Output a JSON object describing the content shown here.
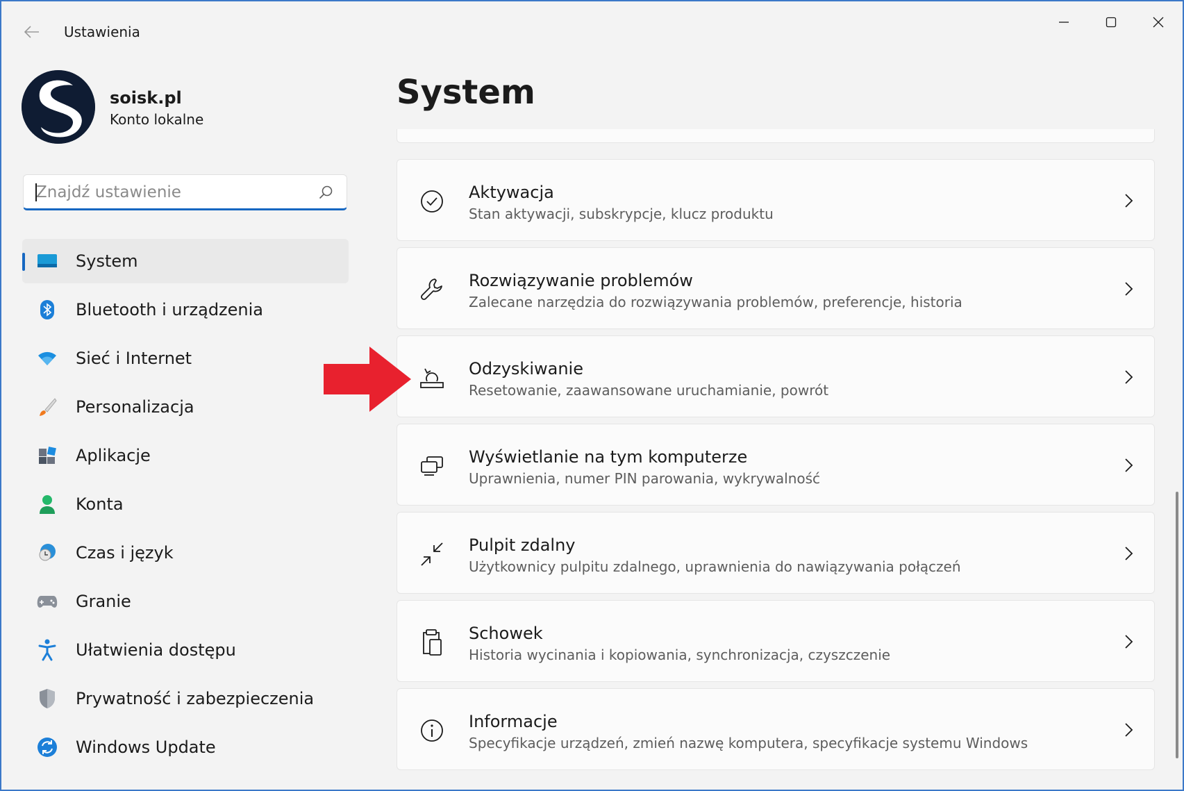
{
  "window": {
    "title": "Ustawienia"
  },
  "profile": {
    "name": "soisk.pl",
    "account_type": "Konto lokalne"
  },
  "search": {
    "placeholder": "Znajdź ustawienie"
  },
  "nav": {
    "items": [
      {
        "label": "System",
        "icon": "system-icon",
        "active": true
      },
      {
        "label": "Bluetooth i urządzenia",
        "icon": "bluetooth-icon"
      },
      {
        "label": "Sieć i Internet",
        "icon": "wifi-icon"
      },
      {
        "label": "Personalizacja",
        "icon": "brush-icon"
      },
      {
        "label": "Aplikacje",
        "icon": "apps-icon"
      },
      {
        "label": "Konta",
        "icon": "account-icon"
      },
      {
        "label": "Czas i język",
        "icon": "time-language-icon"
      },
      {
        "label": "Granie",
        "icon": "gamepad-icon"
      },
      {
        "label": "Ułatwienia dostępu",
        "icon": "accessibility-icon"
      },
      {
        "label": "Prywatność i zabezpieczenia",
        "icon": "shield-icon"
      },
      {
        "label": "Windows Update",
        "icon": "windows-update-icon"
      }
    ]
  },
  "main": {
    "title": "System",
    "cards": [
      {
        "title": "Aktywacja",
        "subtitle": "Stan aktywacji, subskrypcje, klucz produktu",
        "icon": "check-circle-icon"
      },
      {
        "title": "Rozwiązywanie problemów",
        "subtitle": "Zalecane narzędzia do rozwiązywania problemów, preferencje, historia",
        "icon": "wrench-icon"
      },
      {
        "title": "Odzyskiwanie",
        "subtitle": "Resetowanie, zaawansowane uruchamianie, powrót",
        "icon": "recovery-icon"
      },
      {
        "title": "Wyświetlanie na tym komputerze",
        "subtitle": "Uprawnienia, numer PIN parowania, wykrywalność",
        "icon": "project-icon"
      },
      {
        "title": "Pulpit zdalny",
        "subtitle": "Użytkownicy pulpitu zdalnego, uprawnienia do nawiązywania połączeń",
        "icon": "remote-desktop-icon"
      },
      {
        "title": "Schowek",
        "subtitle": "Historia wycinania i kopiowania, synchronizacja, czyszczenie",
        "icon": "clipboard-icon"
      },
      {
        "title": "Informacje",
        "subtitle": "Specyfikacje urządzeń, zmień nazwę komputera, specyfikacje systemu Windows",
        "icon": "info-icon"
      }
    ]
  },
  "colors": {
    "accent": "#1667c1",
    "annotation_arrow": "#e8212e",
    "window_bg": "#f3f3f3"
  }
}
